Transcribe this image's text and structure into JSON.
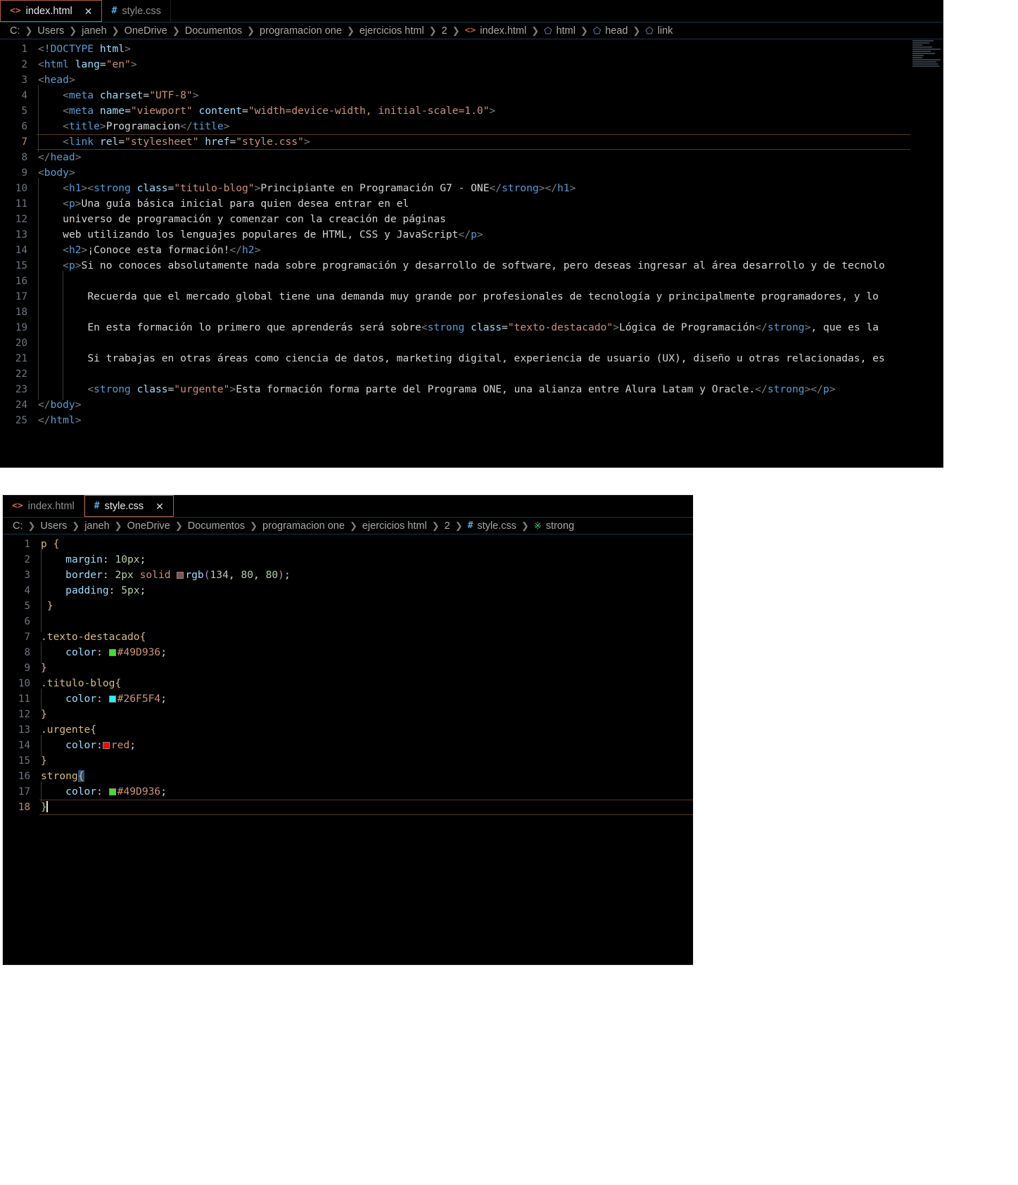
{
  "html_editor": {
    "tabs": [
      {
        "label": "index.html",
        "icon": "html-file-icon",
        "active": true,
        "closable": true
      },
      {
        "label": "style.css",
        "icon": "css-file-icon",
        "active": false,
        "closable": false
      }
    ],
    "breadcrumb": [
      {
        "label": "C:",
        "icon": ""
      },
      {
        "label": "Users",
        "icon": ""
      },
      {
        "label": "janeh",
        "icon": ""
      },
      {
        "label": "OneDrive",
        "icon": ""
      },
      {
        "label": "Documentos",
        "icon": ""
      },
      {
        "label": "programacion one",
        "icon": ""
      },
      {
        "label": "ejercicios html",
        "icon": ""
      },
      {
        "label": "2",
        "icon": ""
      },
      {
        "label": "index.html",
        "icon": "html-file-icon"
      },
      {
        "label": "html",
        "icon": "symbol-cube-icon"
      },
      {
        "label": "head",
        "icon": "symbol-cube-icon"
      },
      {
        "label": "link",
        "icon": "symbol-cube-icon"
      }
    ],
    "active_line": 7,
    "lines": [
      {
        "n": 1,
        "text": "<!DOCTYPE html>"
      },
      {
        "n": 2,
        "text": "<html lang=\"en\">"
      },
      {
        "n": 3,
        "text": "<head>"
      },
      {
        "n": 4,
        "text": "    <meta charset=\"UTF-8\">"
      },
      {
        "n": 5,
        "text": "    <meta name=\"viewport\" content=\"width=device-width, initial-scale=1.0\">"
      },
      {
        "n": 6,
        "text": "    <title>Programacion</title>"
      },
      {
        "n": 7,
        "text": "    <link rel=\"stylesheet\" href=\"style.css\">"
      },
      {
        "n": 8,
        "text": "</head>"
      },
      {
        "n": 9,
        "text": "<body>"
      },
      {
        "n": 10,
        "text": "    <h1><strong class=\"titulo-blog\">Principiante en Programación G7 - ONE</strong></h1>"
      },
      {
        "n": 11,
        "text": "    <p>Una guía básica inicial para quien desea entrar en el"
      },
      {
        "n": 12,
        "text": "    universo de programación y comenzar con la creación de páginas"
      },
      {
        "n": 13,
        "text": "    web utilizando los lenguajes populares de HTML, CSS y JavaScript</p>"
      },
      {
        "n": 14,
        "text": "    <h2>¡Conoce esta formación!</h2>"
      },
      {
        "n": 15,
        "text": "    <p>Si no conoces absolutamente nada sobre programación y desarrollo de software, pero deseas ingresar al área desarrollo y de tecnolo"
      },
      {
        "n": 16,
        "text": ""
      },
      {
        "n": 17,
        "text": "        Recuerda que el mercado global tiene una demanda muy grande por profesionales de tecnología y principalmente programadores, y lo"
      },
      {
        "n": 18,
        "text": ""
      },
      {
        "n": 19,
        "text": "        En esta formación lo primero que aprenderás será sobre<strong class=\"texto-destacado\">Lógica de Programación</strong>, que es la"
      },
      {
        "n": 20,
        "text": ""
      },
      {
        "n": 21,
        "text": "        Si trabajas en otras áreas como ciencia de datos, marketing digital, experiencia de usuario (UX), diseño u otras relacionadas, es"
      },
      {
        "n": 22,
        "text": ""
      },
      {
        "n": 23,
        "text": "        <strong class=\"urgente\">Esta formación forma parte del Programa ONE, una alianza entre Alura Latam y Oracle.</strong></p>"
      },
      {
        "n": 24,
        "text": "</body>"
      },
      {
        "n": 25,
        "text": "</html>"
      }
    ]
  },
  "css_editor": {
    "tabs": [
      {
        "label": "index.html",
        "icon": "html-file-icon",
        "active": false,
        "closable": false
      },
      {
        "label": "style.css",
        "icon": "css-file-icon",
        "active": true,
        "closable": true
      }
    ],
    "breadcrumb": [
      {
        "label": "C:",
        "icon": ""
      },
      {
        "label": "Users",
        "icon": ""
      },
      {
        "label": "janeh",
        "icon": ""
      },
      {
        "label": "OneDrive",
        "icon": ""
      },
      {
        "label": "Documentos",
        "icon": ""
      },
      {
        "label": "programacion one",
        "icon": ""
      },
      {
        "label": "ejercicios html",
        "icon": ""
      },
      {
        "label": "2",
        "icon": ""
      },
      {
        "label": "style.css",
        "icon": "css-file-icon"
      },
      {
        "label": "strong",
        "icon": "css-rule-icon"
      }
    ],
    "active_line": 18,
    "colors": {
      "border_rgb": "rgb(134, 80, 80)",
      "texto_destacado": "#49D936",
      "titulo_blog": "#26F5F4",
      "urgente": "red",
      "strong": "#49D936"
    },
    "lines": [
      {
        "n": 1,
        "text": "p {"
      },
      {
        "n": 2,
        "text": "    margin: 10px;"
      },
      {
        "n": 3,
        "text": "    border: 2px solid rgb(134, 80, 80);"
      },
      {
        "n": 4,
        "text": "    padding: 5px;"
      },
      {
        "n": 5,
        "text": "}"
      },
      {
        "n": 6,
        "text": ""
      },
      {
        "n": 7,
        "text": ".texto-destacado{"
      },
      {
        "n": 8,
        "text": "    color: #49D936;"
      },
      {
        "n": 9,
        "text": "}"
      },
      {
        "n": 10,
        "text": ".titulo-blog{"
      },
      {
        "n": 11,
        "text": "    color: #26F5F4;"
      },
      {
        "n": 12,
        "text": "}"
      },
      {
        "n": 13,
        "text": ".urgente{"
      },
      {
        "n": 14,
        "text": "    color: red;"
      },
      {
        "n": 15,
        "text": "}"
      },
      {
        "n": 16,
        "text": "strong{"
      },
      {
        "n": 17,
        "text": "    color: #49D936;"
      },
      {
        "n": 18,
        "text": "}"
      }
    ]
  }
}
